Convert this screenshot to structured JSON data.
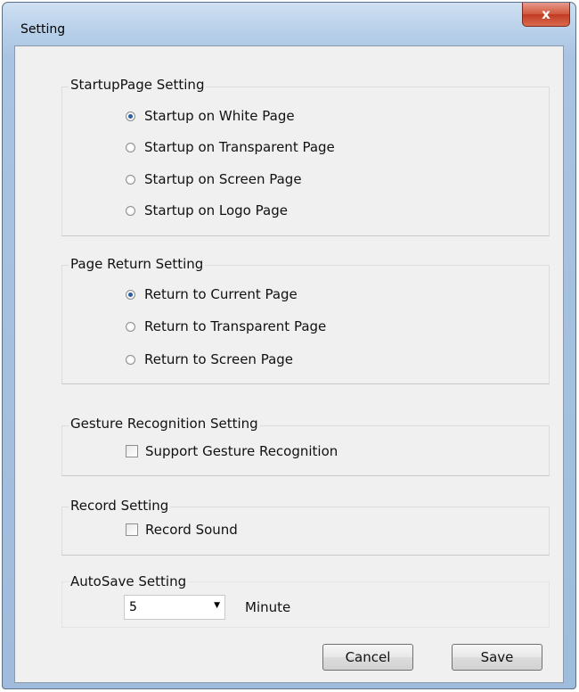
{
  "window": {
    "title": "Setting",
    "close_glyph": "x"
  },
  "startup": {
    "label": "StartupPage Setting",
    "options": [
      {
        "label": "Startup on White Page",
        "checked": true
      },
      {
        "label": "Startup on Transparent Page",
        "checked": false
      },
      {
        "label": "Startup on Screen Page",
        "checked": false
      },
      {
        "label": "Startup on Logo Page",
        "checked": false
      }
    ]
  },
  "page_return": {
    "label": "Page Return Setting",
    "options": [
      {
        "label": "Return to Current Page",
        "checked": true
      },
      {
        "label": "Return to Transparent Page",
        "checked": false
      },
      {
        "label": "Return to Screen Page",
        "checked": false
      }
    ]
  },
  "gesture": {
    "label": "Gesture Recognition Setting",
    "checkbox_label": "Support Gesture Recognition",
    "checked": false
  },
  "record": {
    "label": "Record Setting",
    "checkbox_label": "Record Sound",
    "checked": false
  },
  "autosave": {
    "label": "AutoSave Setting",
    "value": "5",
    "arrow": "▼",
    "unit": "Minute"
  },
  "buttons": {
    "cancel": "Cancel",
    "save": "Save"
  }
}
